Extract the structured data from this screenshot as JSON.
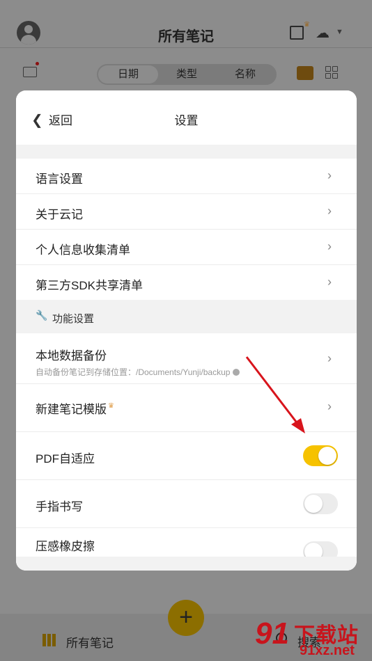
{
  "header": {
    "title": "所有笔记"
  },
  "sort_tabs": [
    {
      "label": "日期",
      "active": true
    },
    {
      "label": "类型",
      "active": false
    },
    {
      "label": "名称",
      "active": false
    }
  ],
  "dialog": {
    "back_label": "返回",
    "title": "设置",
    "rows": [
      {
        "label": "语言设置"
      },
      {
        "label": "关于云记"
      },
      {
        "label": "个人信息收集清单"
      },
      {
        "label": "第三方SDK共享清单"
      }
    ],
    "section_title": "功能设置",
    "backup": {
      "label": "本地数据备份",
      "sub": "自动备份笔记到存储位置：/Documents/Yunji/backup"
    },
    "template": {
      "label": "新建笔记模版"
    },
    "toggles": [
      {
        "label": "PDF自适应",
        "on": true
      },
      {
        "label": "手指书写",
        "on": false
      },
      {
        "label": "压感橡皮擦",
        "on": false
      }
    ]
  },
  "bottom_bar": {
    "notes_label": "所有笔记",
    "search_label": "搜索"
  },
  "watermark": {
    "brand": "下载站",
    "url": "91xz.net"
  },
  "colors": {
    "accent": "#f6c200",
    "annotation_arrow": "#d8141c"
  }
}
